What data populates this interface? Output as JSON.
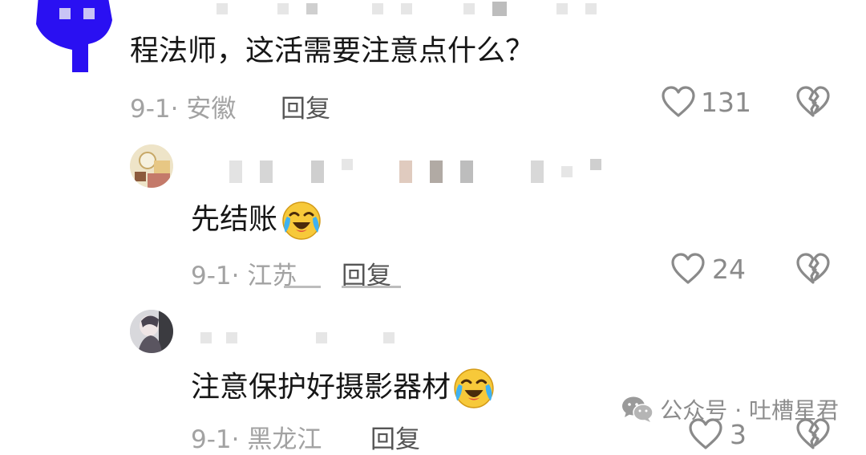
{
  "comments": [
    {
      "text": "程法师，这活需要注意点什么？",
      "date": "9-1· 安徽",
      "reply_label": "回复",
      "likes": "131"
    },
    {
      "text": "先结账",
      "date": "9-1· 江苏",
      "reply_label": "回复",
      "likes": "24"
    },
    {
      "text": "注意保护好摄影器材",
      "date": "9-1· 黑龙江",
      "reply_label": "回复",
      "likes": "3"
    }
  ],
  "watermark": {
    "text": "公众号 · 吐槽星君"
  },
  "icons": {
    "like": "heart-outline-icon",
    "dislike": "broken-heart-icon",
    "emoji": "crying-laughing-emoji",
    "wechat": "wechat-logo-icon"
  },
  "colors": {
    "avatar_blue": "#2a0ff0",
    "meta_gray": "#a2a2a2",
    "emoji_yellow": "#f7c93a"
  }
}
